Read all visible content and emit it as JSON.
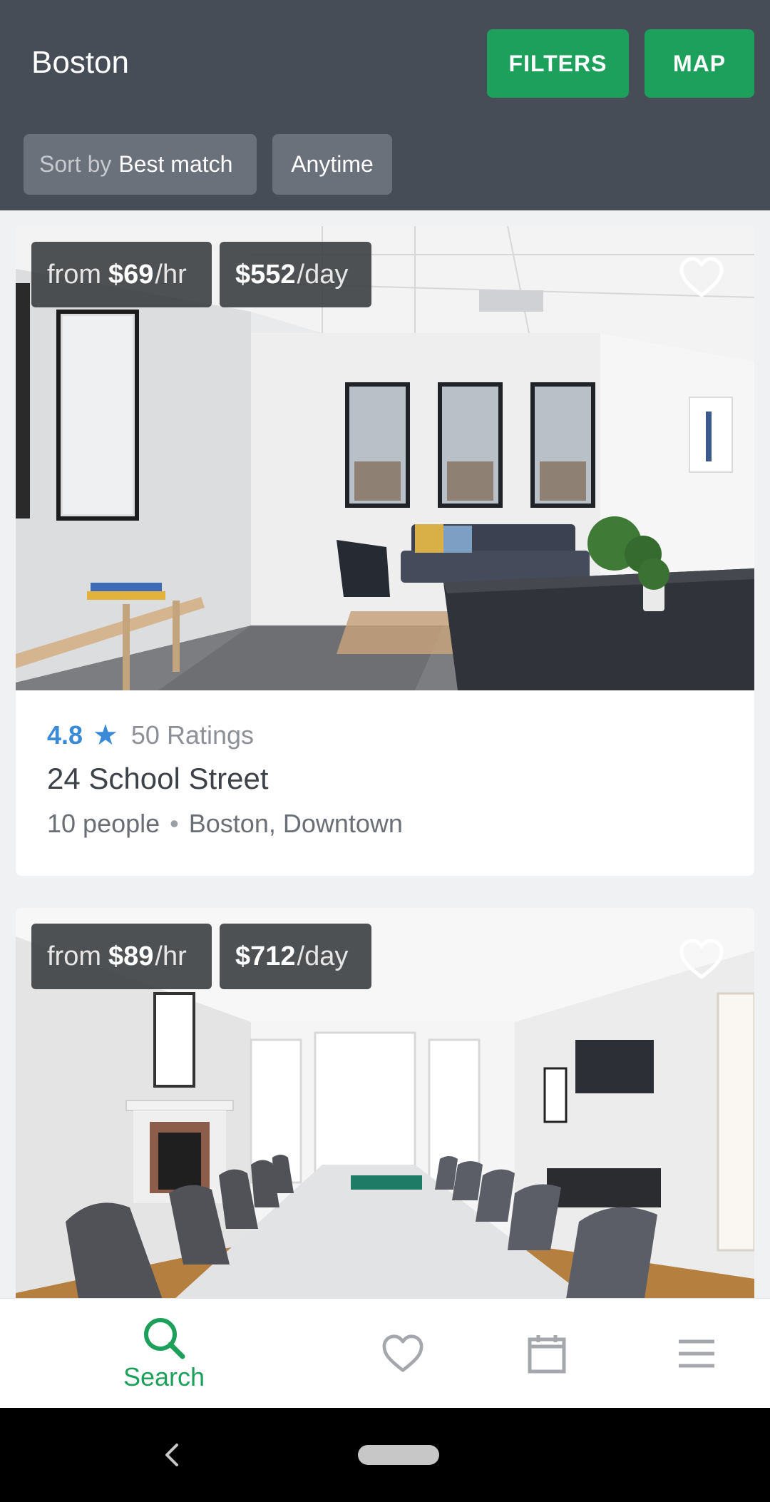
{
  "header": {
    "city": "Boston",
    "filters_label": "FILTERS",
    "map_label": "MAP",
    "sort_prefix": "Sort by",
    "sort_value": "Best match",
    "time_label": "Anytime"
  },
  "listings": [
    {
      "price_hr_prefix": "from",
      "price_hr_value": "$69",
      "price_hr_unit": "/hr",
      "price_day_value": "$552",
      "price_day_unit": "/day",
      "rating": "4.8",
      "ratings_count": "50 Ratings",
      "title": "24 School Street",
      "capacity": "10 people",
      "location": "Boston, Downtown"
    },
    {
      "price_hr_prefix": "from",
      "price_hr_value": "$89",
      "price_hr_unit": "/hr",
      "price_day_value": "$712",
      "price_day_unit": "/day"
    }
  ],
  "bottom_nav": {
    "search_label": "Search",
    "active": "search"
  },
  "colors": {
    "header_bg": "#464d57",
    "accent_green": "#1da05b",
    "rating_blue": "#3a8ad8"
  },
  "icons": [
    "heart-icon",
    "star-icon",
    "search-icon",
    "calendar-icon",
    "menu-icon",
    "back-icon"
  ]
}
